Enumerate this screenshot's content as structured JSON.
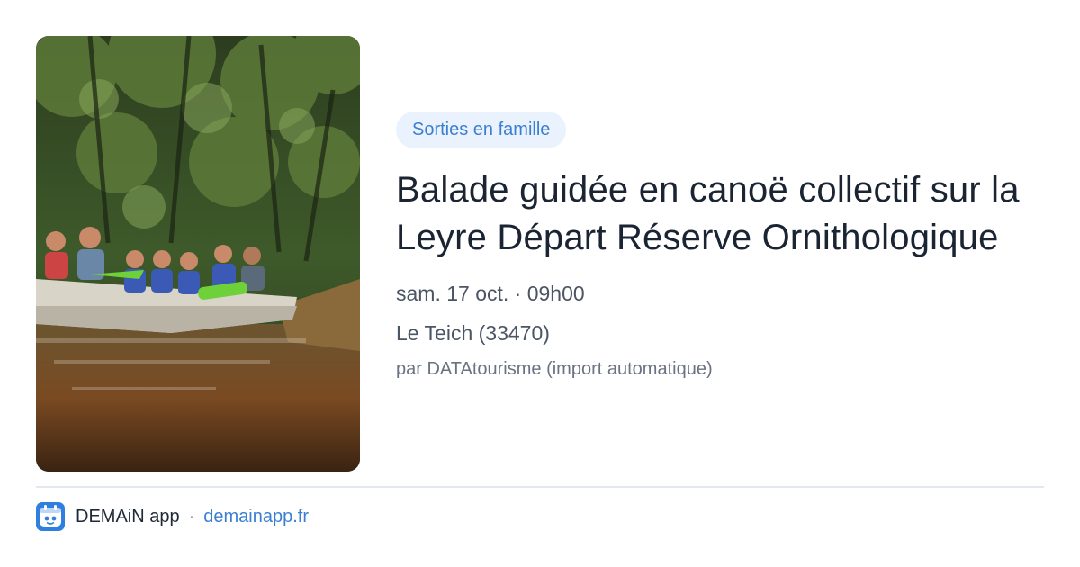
{
  "card": {
    "image_alt": "Groupe en canoë sur la Leyre",
    "tag": "Sorties en famille",
    "title": "Balade guidée en canoë collectif sur la Leyre Départ Réserve Ornithologique",
    "datetime": "sam. 17 oct. · 09h00",
    "location": "Le Teich (33470)",
    "author": "par DATAtourisme (import automatique)"
  },
  "footer": {
    "app_name": "DEMAiN app",
    "separator": "·",
    "domain": "demainapp.fr"
  },
  "colors": {
    "accent": "#3b7fd1",
    "tag_bg": "#eaf2fe",
    "icon_bg": "#2f7fde"
  },
  "icons": {
    "app": "demain-app-icon"
  }
}
